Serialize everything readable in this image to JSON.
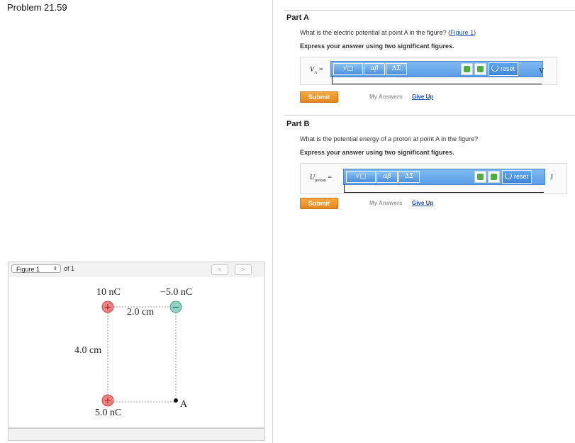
{
  "problem": {
    "title": "Problem 21.59"
  },
  "partA": {
    "title": "Part A",
    "question_text": "What is the electric potential at point A in the figure? (",
    "question_link": "Figure 1",
    "question_end": ")",
    "instruction": "Express your answer using two significant figures.",
    "var_main": "V",
    "var_sub": "A",
    "equals": "=",
    "unit": "V",
    "submit": "Submit",
    "my_answers": "My Answers",
    "give_up": "Give Up"
  },
  "partB": {
    "title": "Part B",
    "question_text": "What is the potential energy of a proton at point A in the figure?",
    "instruction": "Express your answer using two significant figures.",
    "var_main": "U",
    "var_sub": "proton",
    "equals": "=",
    "unit": "J",
    "submit": "Submit",
    "my_answers": "My Answers",
    "give_up": "Give Up"
  },
  "toolbar": {
    "templates": "√□",
    "greek": "αβ",
    "symbols": "ΔΣ",
    "reset": "reset",
    "colors": {
      "bar": "#5a9de6",
      "undo": "#4cae3c"
    }
  },
  "figure": {
    "selector": "Figure 1",
    "of": "of 1",
    "prev": "<",
    "next": ">",
    "labels": {
      "q1": "10 nC",
      "q2": "−5.0 nC",
      "q3": "5.0 nC",
      "width": "2.0 cm",
      "height": "4.0 cm",
      "point": "A",
      "plus": "+",
      "minus": "−"
    },
    "colors": {
      "positive": "#f08080",
      "negative": "#8fd3c4"
    }
  }
}
